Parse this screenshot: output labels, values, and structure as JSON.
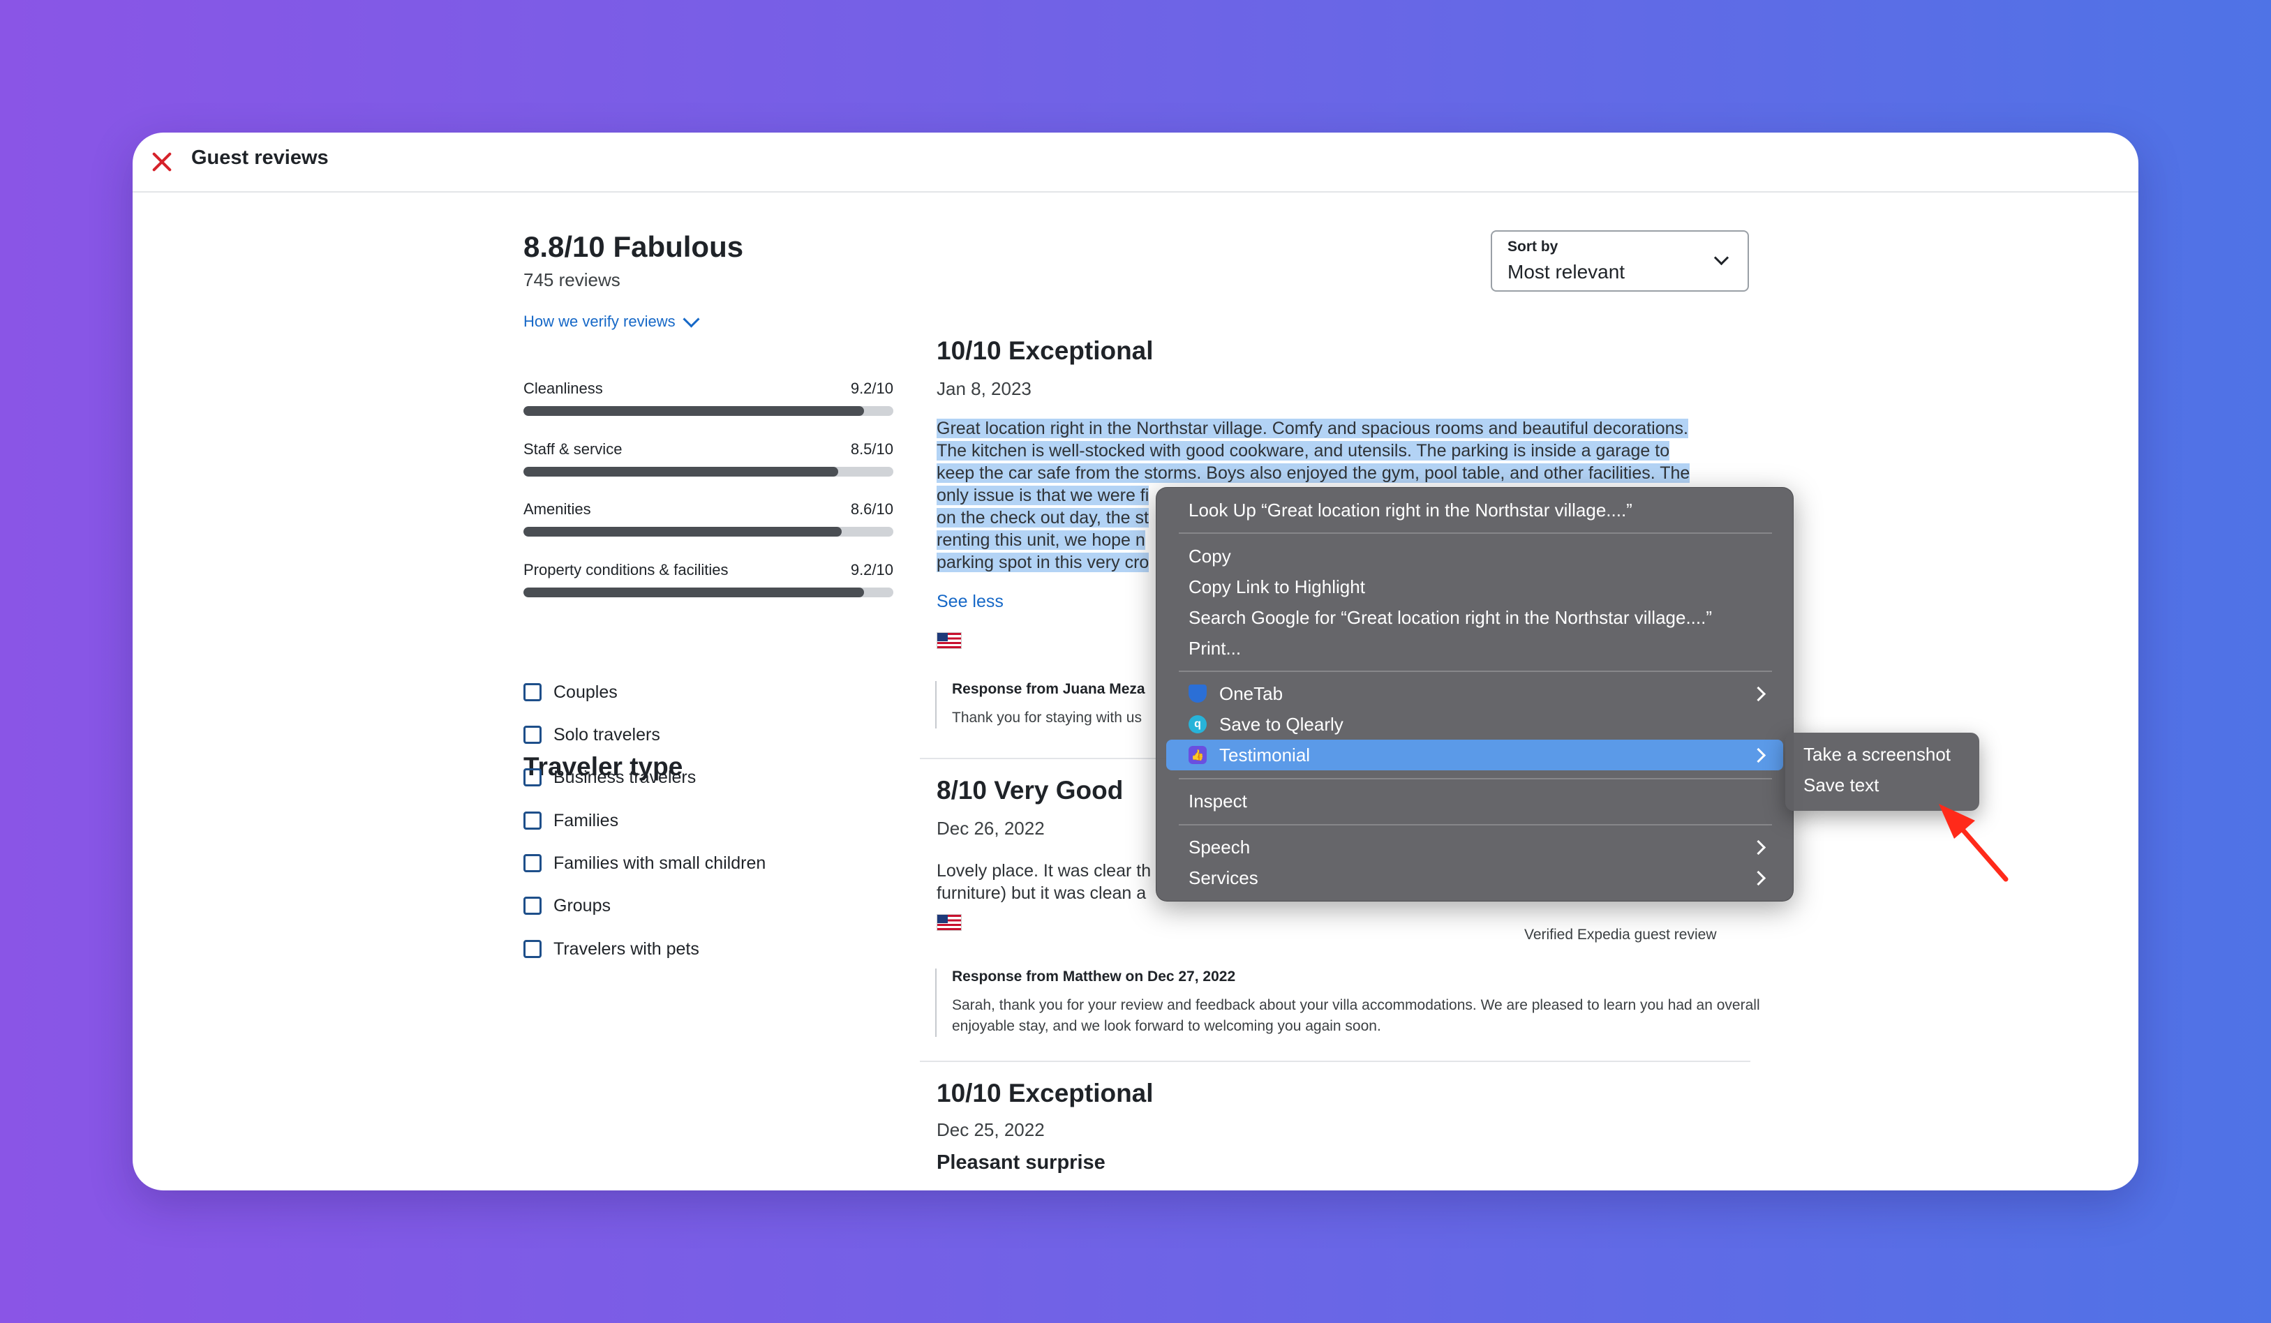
{
  "window": {
    "title": "Guest reviews"
  },
  "summary": {
    "rating_title": "8.8/10 Fabulous",
    "review_count": "745 reviews",
    "verify_link": "How we verify reviews"
  },
  "categories": [
    {
      "label": "Cleanliness",
      "value": "9.2/10",
      "fraction": 0.92
    },
    {
      "label": "Staff & service",
      "value": "8.5/10",
      "fraction": 0.85
    },
    {
      "label": "Amenities",
      "value": "8.6/10",
      "fraction": 0.86
    },
    {
      "label": "Property conditions & facilities",
      "value": "9.2/10",
      "fraction": 0.92
    }
  ],
  "traveler": {
    "title": "Traveler type",
    "options": [
      "Couples",
      "Solo travelers",
      "Business travelers",
      "Families",
      "Families with small children",
      "Groups",
      "Travelers with pets"
    ]
  },
  "sort": {
    "label": "Sort by",
    "value": "Most relevant"
  },
  "reviews": [
    {
      "title": "10/10 Exceptional",
      "date": "Jan 8, 2023",
      "lines": [
        "Great location right in the Northstar village. Comfy and spacious rooms and beautiful decorations.",
        "The kitchen is well-stocked with good cookware, and utensils. The parking is inside a garage to",
        "keep the car safe from the storms. Boys also enjoyed the gym, pool table, and other facilities. The",
        "only issue is that we were fi",
        "on the check out day, the st",
        "renting this unit, we hope n",
        "parking spot in this very cro"
      ],
      "see_less": "See less",
      "response_head": "Response from Juana Meza",
      "response_body": "Thank you for staying with us"
    },
    {
      "title": "8/10 Very Good",
      "date": "Dec 26, 2022",
      "lines": [
        "Lovely place. It was clear th",
        "furniture) but it was clean a"
      ],
      "verified": "Verified Expedia guest review",
      "response_head": "Response from Matthew on Dec 27, 2022",
      "response_body": "Sarah, thank you for your review and feedback about your villa accommodations. We are pleased to learn you had an overall enjoyable stay, and we look forward to welcoming you again soon."
    },
    {
      "title": "10/10 Exceptional",
      "date": "Dec 25, 2022",
      "subtitle": "Pleasant surprise"
    }
  ],
  "context_menu": {
    "look_up": "Look Up “Great location right in the Northstar village....”",
    "copy": "Copy",
    "copy_link": "Copy Link to Highlight",
    "search_google": "Search Google for “Great location right in the Northstar village....”",
    "print": "Print...",
    "onetab": "OneTab",
    "qlearly": "Save to Qlearly",
    "testimonial": "Testimonial",
    "inspect": "Inspect",
    "speech": "Speech",
    "services": "Services"
  },
  "submenu": {
    "screenshot": "Take a screenshot",
    "save_text": "Save text"
  },
  "colors": {
    "accent": "#1668c7",
    "selection": "#b3d3f5",
    "menu_highlight": "#5b9ae8",
    "annotation_arrow": "#ff2a1a"
  }
}
